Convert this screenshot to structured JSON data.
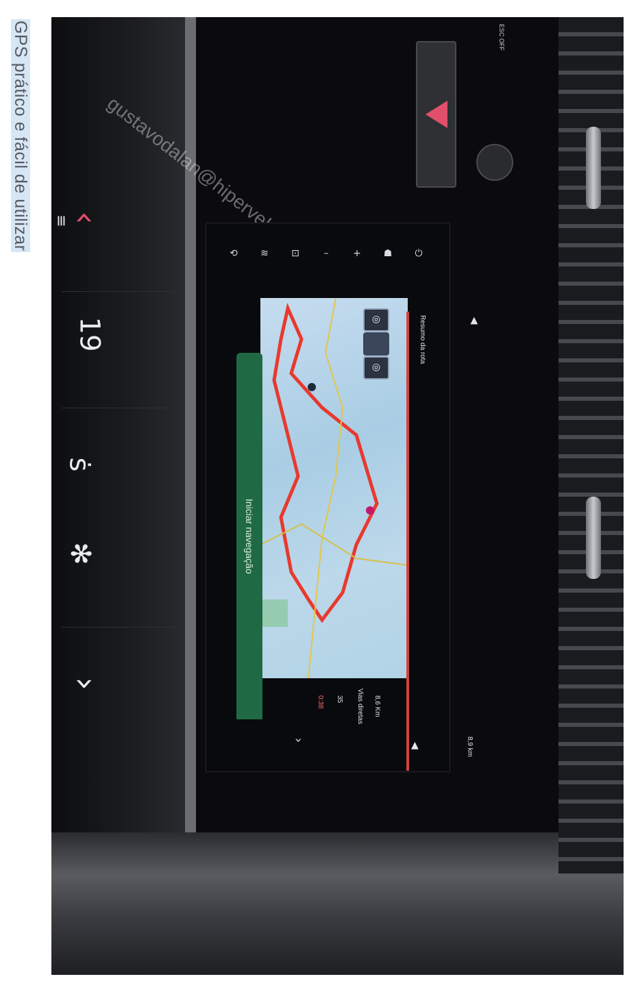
{
  "caption": "GPS prático e fácil de utilizar",
  "watermark": "gustavodalan@hiperveI.com",
  "console": {
    "hazard_label": "ESC OFF",
    "left_controls": {
      "chevron_up": "‹",
      "menu": "≡",
      "temp_left": "19",
      "seat_heat": "ṡ",
      "fan": "✻",
      "chevron_down": "›"
    }
  },
  "screen": {
    "route_header": "Resumo da rota",
    "start_button": "Iniciar navegação",
    "side_icons": [
      "⟲",
      "≋",
      "⊡",
      "–",
      "+",
      "☗",
      "⏻"
    ],
    "map_buttons": [
      "◎",
      "",
      "◎"
    ],
    "info": {
      "distance": "8,9 km",
      "time1": "0:38",
      "time2": "35",
      "eta": "8,6 Km",
      "summary": "Vias diretas"
    }
  },
  "colors": {
    "route": "#e8392e",
    "accent_red": "#e24d6a",
    "button_green": "#1f6a44"
  }
}
